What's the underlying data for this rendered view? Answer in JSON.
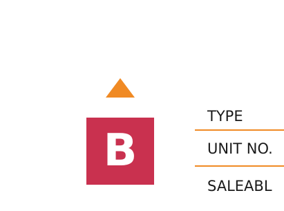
{
  "unit_badge": {
    "letter": "B"
  },
  "info_rows": [
    {
      "label": "TYPE"
    },
    {
      "label": "UNIT NO."
    },
    {
      "label": "SALEABL"
    }
  ],
  "colors": {
    "accent": "#f08a24",
    "badge": "#c9314f"
  },
  "icons": {
    "arrow": "arrow-up-icon"
  }
}
